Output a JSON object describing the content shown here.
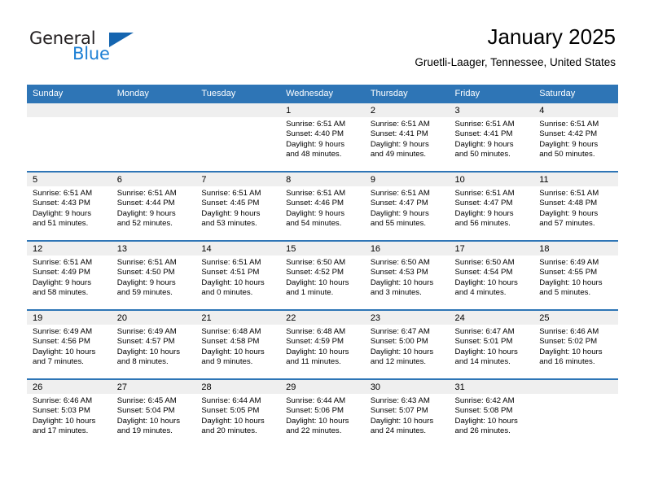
{
  "brand": {
    "name_part1": "General",
    "name_part2": "Blue",
    "flag_icon": "triangle-flag-icon",
    "accent_color": "#1565b0",
    "blue_text_color": "#1c7fd4"
  },
  "header": {
    "title": "January 2025",
    "subtitle": "Gruetli-Laager, Tennessee, United States"
  },
  "calendar": {
    "header_background": "#2e75b6",
    "daynum_background": "#efefef",
    "weekday_headers": [
      "Sunday",
      "Monday",
      "Tuesday",
      "Wednesday",
      "Thursday",
      "Friday",
      "Saturday"
    ],
    "weeks": [
      [
        {
          "day": "",
          "sunrise": "",
          "sunset": "",
          "daylight_line1": "",
          "daylight_line2": "",
          "blank": true
        },
        {
          "day": "",
          "sunrise": "",
          "sunset": "",
          "daylight_line1": "",
          "daylight_line2": "",
          "blank": true
        },
        {
          "day": "",
          "sunrise": "",
          "sunset": "",
          "daylight_line1": "",
          "daylight_line2": "",
          "blank": true
        },
        {
          "day": "1",
          "sunrise": "Sunrise: 6:51 AM",
          "sunset": "Sunset: 4:40 PM",
          "daylight_line1": "Daylight: 9 hours",
          "daylight_line2": "and 48 minutes."
        },
        {
          "day": "2",
          "sunrise": "Sunrise: 6:51 AM",
          "sunset": "Sunset: 4:41 PM",
          "daylight_line1": "Daylight: 9 hours",
          "daylight_line2": "and 49 minutes."
        },
        {
          "day": "3",
          "sunrise": "Sunrise: 6:51 AM",
          "sunset": "Sunset: 4:41 PM",
          "daylight_line1": "Daylight: 9 hours",
          "daylight_line2": "and 50 minutes."
        },
        {
          "day": "4",
          "sunrise": "Sunrise: 6:51 AM",
          "sunset": "Sunset: 4:42 PM",
          "daylight_line1": "Daylight: 9 hours",
          "daylight_line2": "and 50 minutes."
        }
      ],
      [
        {
          "day": "5",
          "sunrise": "Sunrise: 6:51 AM",
          "sunset": "Sunset: 4:43 PM",
          "daylight_line1": "Daylight: 9 hours",
          "daylight_line2": "and 51 minutes."
        },
        {
          "day": "6",
          "sunrise": "Sunrise: 6:51 AM",
          "sunset": "Sunset: 4:44 PM",
          "daylight_line1": "Daylight: 9 hours",
          "daylight_line2": "and 52 minutes."
        },
        {
          "day": "7",
          "sunrise": "Sunrise: 6:51 AM",
          "sunset": "Sunset: 4:45 PM",
          "daylight_line1": "Daylight: 9 hours",
          "daylight_line2": "and 53 minutes."
        },
        {
          "day": "8",
          "sunrise": "Sunrise: 6:51 AM",
          "sunset": "Sunset: 4:46 PM",
          "daylight_line1": "Daylight: 9 hours",
          "daylight_line2": "and 54 minutes."
        },
        {
          "day": "9",
          "sunrise": "Sunrise: 6:51 AM",
          "sunset": "Sunset: 4:47 PM",
          "daylight_line1": "Daylight: 9 hours",
          "daylight_line2": "and 55 minutes."
        },
        {
          "day": "10",
          "sunrise": "Sunrise: 6:51 AM",
          "sunset": "Sunset: 4:47 PM",
          "daylight_line1": "Daylight: 9 hours",
          "daylight_line2": "and 56 minutes."
        },
        {
          "day": "11",
          "sunrise": "Sunrise: 6:51 AM",
          "sunset": "Sunset: 4:48 PM",
          "daylight_line1": "Daylight: 9 hours",
          "daylight_line2": "and 57 minutes."
        }
      ],
      [
        {
          "day": "12",
          "sunrise": "Sunrise: 6:51 AM",
          "sunset": "Sunset: 4:49 PM",
          "daylight_line1": "Daylight: 9 hours",
          "daylight_line2": "and 58 minutes."
        },
        {
          "day": "13",
          "sunrise": "Sunrise: 6:51 AM",
          "sunset": "Sunset: 4:50 PM",
          "daylight_line1": "Daylight: 9 hours",
          "daylight_line2": "and 59 minutes."
        },
        {
          "day": "14",
          "sunrise": "Sunrise: 6:51 AM",
          "sunset": "Sunset: 4:51 PM",
          "daylight_line1": "Daylight: 10 hours",
          "daylight_line2": "and 0 minutes."
        },
        {
          "day": "15",
          "sunrise": "Sunrise: 6:50 AM",
          "sunset": "Sunset: 4:52 PM",
          "daylight_line1": "Daylight: 10 hours",
          "daylight_line2": "and 1 minute."
        },
        {
          "day": "16",
          "sunrise": "Sunrise: 6:50 AM",
          "sunset": "Sunset: 4:53 PM",
          "daylight_line1": "Daylight: 10 hours",
          "daylight_line2": "and 3 minutes."
        },
        {
          "day": "17",
          "sunrise": "Sunrise: 6:50 AM",
          "sunset": "Sunset: 4:54 PM",
          "daylight_line1": "Daylight: 10 hours",
          "daylight_line2": "and 4 minutes."
        },
        {
          "day": "18",
          "sunrise": "Sunrise: 6:49 AM",
          "sunset": "Sunset: 4:55 PM",
          "daylight_line1": "Daylight: 10 hours",
          "daylight_line2": "and 5 minutes."
        }
      ],
      [
        {
          "day": "19",
          "sunrise": "Sunrise: 6:49 AM",
          "sunset": "Sunset: 4:56 PM",
          "daylight_line1": "Daylight: 10 hours",
          "daylight_line2": "and 7 minutes."
        },
        {
          "day": "20",
          "sunrise": "Sunrise: 6:49 AM",
          "sunset": "Sunset: 4:57 PM",
          "daylight_line1": "Daylight: 10 hours",
          "daylight_line2": "and 8 minutes."
        },
        {
          "day": "21",
          "sunrise": "Sunrise: 6:48 AM",
          "sunset": "Sunset: 4:58 PM",
          "daylight_line1": "Daylight: 10 hours",
          "daylight_line2": "and 9 minutes."
        },
        {
          "day": "22",
          "sunrise": "Sunrise: 6:48 AM",
          "sunset": "Sunset: 4:59 PM",
          "daylight_line1": "Daylight: 10 hours",
          "daylight_line2": "and 11 minutes."
        },
        {
          "day": "23",
          "sunrise": "Sunrise: 6:47 AM",
          "sunset": "Sunset: 5:00 PM",
          "daylight_line1": "Daylight: 10 hours",
          "daylight_line2": "and 12 minutes."
        },
        {
          "day": "24",
          "sunrise": "Sunrise: 6:47 AM",
          "sunset": "Sunset: 5:01 PM",
          "daylight_line1": "Daylight: 10 hours",
          "daylight_line2": "and 14 minutes."
        },
        {
          "day": "25",
          "sunrise": "Sunrise: 6:46 AM",
          "sunset": "Sunset: 5:02 PM",
          "daylight_line1": "Daylight: 10 hours",
          "daylight_line2": "and 16 minutes."
        }
      ],
      [
        {
          "day": "26",
          "sunrise": "Sunrise: 6:46 AM",
          "sunset": "Sunset: 5:03 PM",
          "daylight_line1": "Daylight: 10 hours",
          "daylight_line2": "and 17 minutes."
        },
        {
          "day": "27",
          "sunrise": "Sunrise: 6:45 AM",
          "sunset": "Sunset: 5:04 PM",
          "daylight_line1": "Daylight: 10 hours",
          "daylight_line2": "and 19 minutes."
        },
        {
          "day": "28",
          "sunrise": "Sunrise: 6:44 AM",
          "sunset": "Sunset: 5:05 PM",
          "daylight_line1": "Daylight: 10 hours",
          "daylight_line2": "and 20 minutes."
        },
        {
          "day": "29",
          "sunrise": "Sunrise: 6:44 AM",
          "sunset": "Sunset: 5:06 PM",
          "daylight_line1": "Daylight: 10 hours",
          "daylight_line2": "and 22 minutes."
        },
        {
          "day": "30",
          "sunrise": "Sunrise: 6:43 AM",
          "sunset": "Sunset: 5:07 PM",
          "daylight_line1": "Daylight: 10 hours",
          "daylight_line2": "and 24 minutes."
        },
        {
          "day": "31",
          "sunrise": "Sunrise: 6:42 AM",
          "sunset": "Sunset: 5:08 PM",
          "daylight_line1": "Daylight: 10 hours",
          "daylight_line2": "and 26 minutes."
        },
        {
          "day": "",
          "sunrise": "",
          "sunset": "",
          "daylight_line1": "",
          "daylight_line2": "",
          "blank": true
        }
      ]
    ]
  }
}
